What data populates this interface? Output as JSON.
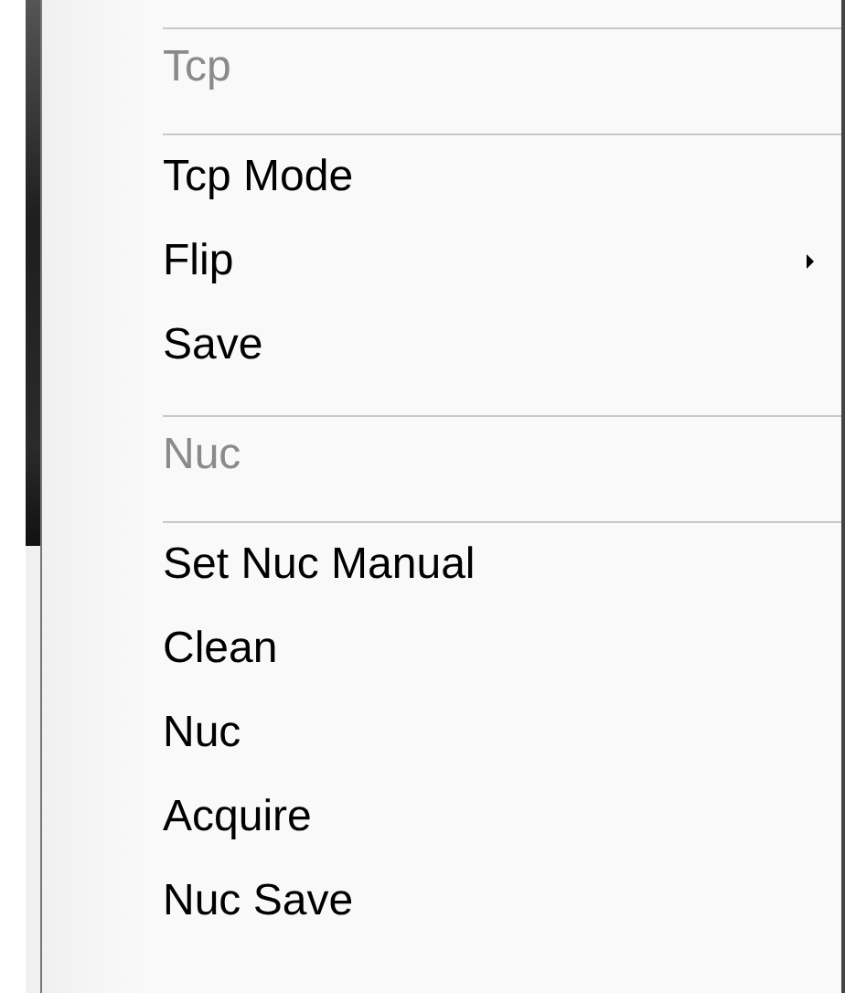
{
  "menu": {
    "items": [
      {
        "kind": "separator"
      },
      {
        "kind": "header",
        "label": "Tcp",
        "disabled": true
      },
      {
        "kind": "separator"
      },
      {
        "kind": "item",
        "label": "Tcp Mode",
        "submenu": false
      },
      {
        "kind": "item",
        "label": "Flip",
        "submenu": true
      },
      {
        "kind": "item",
        "label": "Save",
        "submenu": false
      },
      {
        "kind": "separator"
      },
      {
        "kind": "header",
        "label": "Nuc",
        "disabled": true
      },
      {
        "kind": "separator"
      },
      {
        "kind": "item",
        "label": "Set Nuc Manual",
        "submenu": false
      },
      {
        "kind": "item",
        "label": "Clean",
        "submenu": false
      },
      {
        "kind": "item",
        "label": "Nuc",
        "submenu": false
      },
      {
        "kind": "item",
        "label": "Acquire",
        "submenu": false
      },
      {
        "kind": "item",
        "label": "Nuc Save",
        "submenu": false
      }
    ]
  }
}
